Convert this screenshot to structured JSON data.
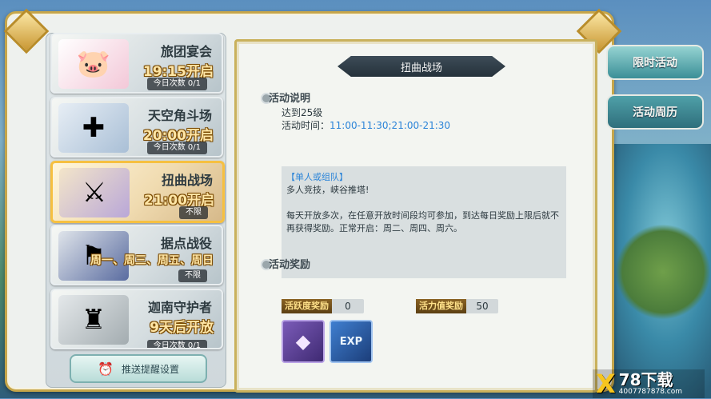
{
  "activities": [
    {
      "name": "旅团宴会",
      "time": "19:15开启",
      "count": "今日次数 0/1"
    },
    {
      "name": "天空角斗场",
      "time": "20:00开启",
      "count": "今日次数 0/1"
    },
    {
      "name": "扭曲战场",
      "time": "21:00开启",
      "count": "不限"
    },
    {
      "name": "据点战役",
      "time": "周一、周三、周五、周日",
      "count": "不限"
    },
    {
      "name": "迦南守护者",
      "time": "9天后开放",
      "count": "今日次数 0/1"
    }
  ],
  "remind_button": "推送提醒设置",
  "detail": {
    "title": "扭曲战场",
    "desc_section": "活动说明",
    "level_req": "达到25级",
    "time_label": "活动时间：",
    "time_value": "11:00-11:30;21:00-21:30",
    "desc_tag": "【单人或组队】",
    "desc_line1": "多人竞技，峡谷推塔!",
    "desc_line2": "每天开放多次，在任意开放时间段均可参加，到达每日奖励上限后就不再获得奖励。正常开启：周二、周四、周六。",
    "reward_section": "活动奖励",
    "reward_active_label": "活跃度奖励",
    "reward_active_value": "0",
    "reward_vitality_label": "活力值奖励",
    "reward_vitality_value": "50",
    "item_exp_label": "EXP"
  },
  "side_tabs": [
    "限时活动",
    "活动周历"
  ],
  "watermark": {
    "brand": "78下载",
    "phone": "4007787878.com",
    "x": "X"
  }
}
